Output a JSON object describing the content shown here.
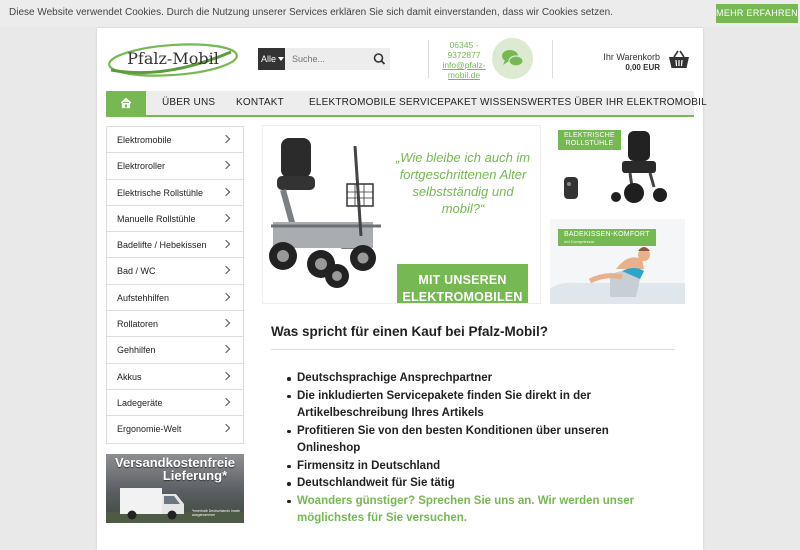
{
  "cookie": {
    "text": "Diese Website verwendet Cookies. Durch die Nutzung unserer Services erklären Sie sich damit einverstanden, dass wir Cookies setzen.",
    "button": "MEHR ERFAHREN"
  },
  "header": {
    "logo_text": "Pfalz-Mobil",
    "search_category": "Alle",
    "search_placeholder": "Suche...",
    "phone": "06345 - 9372877",
    "email": "info@pfalz-mobil.de",
    "cart_label": "Ihr Warenkorb",
    "cart_total": "0,00 EUR"
  },
  "nav": {
    "items": [
      "ÜBER UNS",
      "KONTAKT",
      "ELEKTROMOBILE SERVICEPAKET",
      "WISSENSWERTES ÜBER IHR ELEKTROMOBIL"
    ]
  },
  "sidebar": {
    "items": [
      "Elektromobile",
      "Elektroroller",
      "Elektrische Rollstühle",
      "Manuelle Rollstühle",
      "Badelifte / Hebekissen",
      "Bad / WC",
      "Aufstehhilfen",
      "Rollatoren",
      "Gehhilfen",
      "Akkus",
      "Ladegeräte",
      "Ergonomie-Welt"
    ]
  },
  "shipping_banner": {
    "title_line1": "Versandkostenfreie",
    "title_line2": "Lieferung*",
    "note": "*innerhalb Deutschlands Inseln ausgenommen"
  },
  "hero": {
    "quote": "„Wie bleibe ich auch im fortgeschrittenen Alter selbstständig und mobil?“",
    "button_line1": "MIT UNSEREN",
    "button_line2": "ELEKTROMOBILEN"
  },
  "side_banners": {
    "wheelchair_tag_line1": "ELEKTRISCHE",
    "wheelchair_tag_line2": "ROLLSTÜHLE",
    "bath_tag_line1": "BADEKISSEN-KOMFORT",
    "bath_tag_line2": "mit Kompressor"
  },
  "content": {
    "title": "Was spricht für einen Kauf bei Pfalz-Mobil?",
    "features": [
      "Deutschsprachige Ansprechpartner",
      "Die inkludierten Servicepakete finden Sie direkt in der Artikelbeschreibung Ihres Artikels",
      "Profitieren Sie von den besten Konditionen über unseren Onlineshop",
      "Firmensitz in Deutschland",
      "Deutschlandweit für Sie tätig"
    ],
    "highlight": "Woanders günstiger? Sprechen Sie uns an. Wir werden unser möglichstes für Sie versuchen."
  },
  "colors": {
    "brand_green": "#76b852",
    "nav_bg": "#ededed",
    "text_dark": "#222222"
  },
  "icons": {
    "search": "search-icon",
    "chat": "chat-icon",
    "cart": "basket-icon",
    "home": "home-icon",
    "chevron": "chevron-right-icon"
  }
}
